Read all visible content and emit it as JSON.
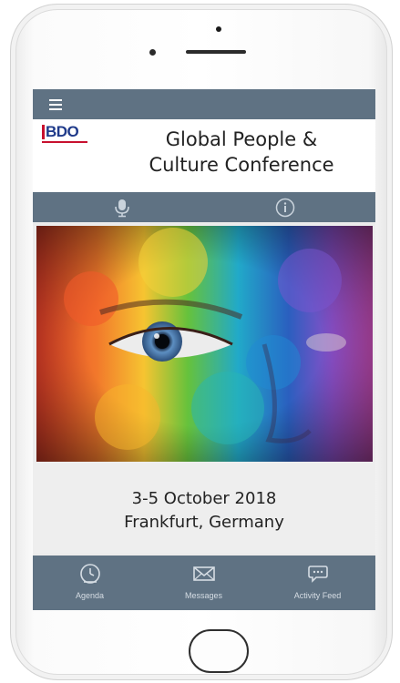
{
  "app": {
    "logo_text": "BDO",
    "title_line1": "Global People &",
    "title_line2": "Culture Conference"
  },
  "actions": {
    "left_icon": "microphone-icon",
    "right_icon": "info-icon"
  },
  "hero": {
    "icon": "rainbow-painted-face-image"
  },
  "event": {
    "date": "3-5 October 2018",
    "location": "Frankfurt, Germany"
  },
  "tabs": [
    {
      "label": "Agenda",
      "icon": "clock-icon"
    },
    {
      "label": "Messages",
      "icon": "envelope-icon"
    },
    {
      "label": "Activity Feed",
      "icon": "speech-bubble-icon"
    }
  ],
  "colors": {
    "bar": "#5f7283",
    "logo_blue": "#1f3a8a",
    "logo_red": "#c8102e"
  }
}
